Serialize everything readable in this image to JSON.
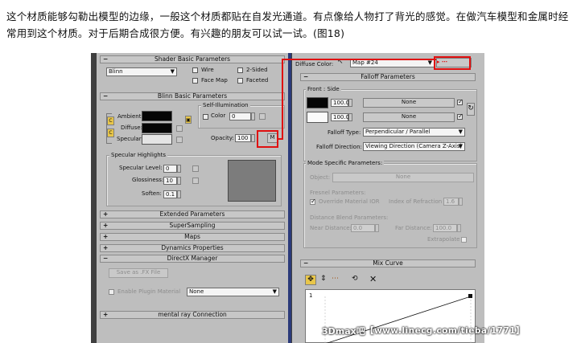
{
  "article": {
    "text": "这个材质能够勾勒出模型的边缘，一般这个材质都贴在自发光通道。有点像给人物打了背光的感觉。在做汽车模型和金属时经常用到这个材质。对于后期合成很方便。有兴趣的朋友可以试一试。(图18)"
  },
  "left_panel": {
    "shader_basic_title": "Shader Basic Parameters",
    "shader_type": "Blinn",
    "wire": "Wire",
    "two_sided": "2-Sided",
    "face_map": "Face Map",
    "faceted": "Faceted",
    "blinn_basic_title": "Blinn Basic Parameters",
    "self_illum": "Self-Illumination",
    "color_label": "Color",
    "color_value": "0",
    "ambient": "Ambient:",
    "diffuse": "Diffuse:",
    "specular": "Specular:",
    "opacity_label": "Opacity:",
    "opacity_value": "100",
    "m_button": "M",
    "specular_highlights": "Specular Highlights",
    "specular_level": "Specular Level:",
    "specular_level_value": "0",
    "glossiness": "Glossiness:",
    "glossiness_value": "10",
    "soften": "Soften:",
    "soften_value": "0.1",
    "rollouts": [
      "Extended Parameters",
      "SuperSampling",
      "Maps",
      "Dynamics Properties",
      "DirectX Manager"
    ],
    "save_fx": "Save as .FX File",
    "enable_plugin": "Enable Plugin Material",
    "plugin_value": "None",
    "mental_ray": "mental ray Connection"
  },
  "right_panel": {
    "diffuse_color_label": "Diffuse Color:",
    "map_name": "Map #24",
    "falloff_title": "Falloff Parameters",
    "front_side": "Front : Side",
    "amount1": "100.0",
    "amount2": "100.0",
    "none1": "None",
    "none2": "None",
    "falloff_type_label": "Falloff Type:",
    "falloff_type_value": "Perpendicular / Parallel",
    "falloff_dir_label": "Falloff Direction:",
    "falloff_dir_value": "Viewing Direction (Camera Z-Axis)",
    "mode_specific": "Mode Specific Parameters:",
    "object_label": "Object:",
    "object_value": "None",
    "fresnel": "Fresnel Parameters:",
    "override_ior": "Override Material IOR",
    "ior_label": "Index of Refraction",
    "ior_value": "1.6",
    "distance_blend": "Distance Blend Parameters:",
    "near_label": "Near Distance:",
    "near_value": "0.0",
    "far_label": "Far Distance:",
    "far_value": "100.0",
    "extrapolate": "Extrapolate",
    "mix_curve": "Mix Curve",
    "curve_axis_top": "1"
  },
  "watermark": {
    "logo": "3Dmax吧",
    "url": "【www.linecg.com/tieba/1771】"
  },
  "colors": {
    "panel_bg": "#bebebe",
    "highlight_red": "#e01010",
    "screenshot_frame": "#3f3f3f"
  }
}
